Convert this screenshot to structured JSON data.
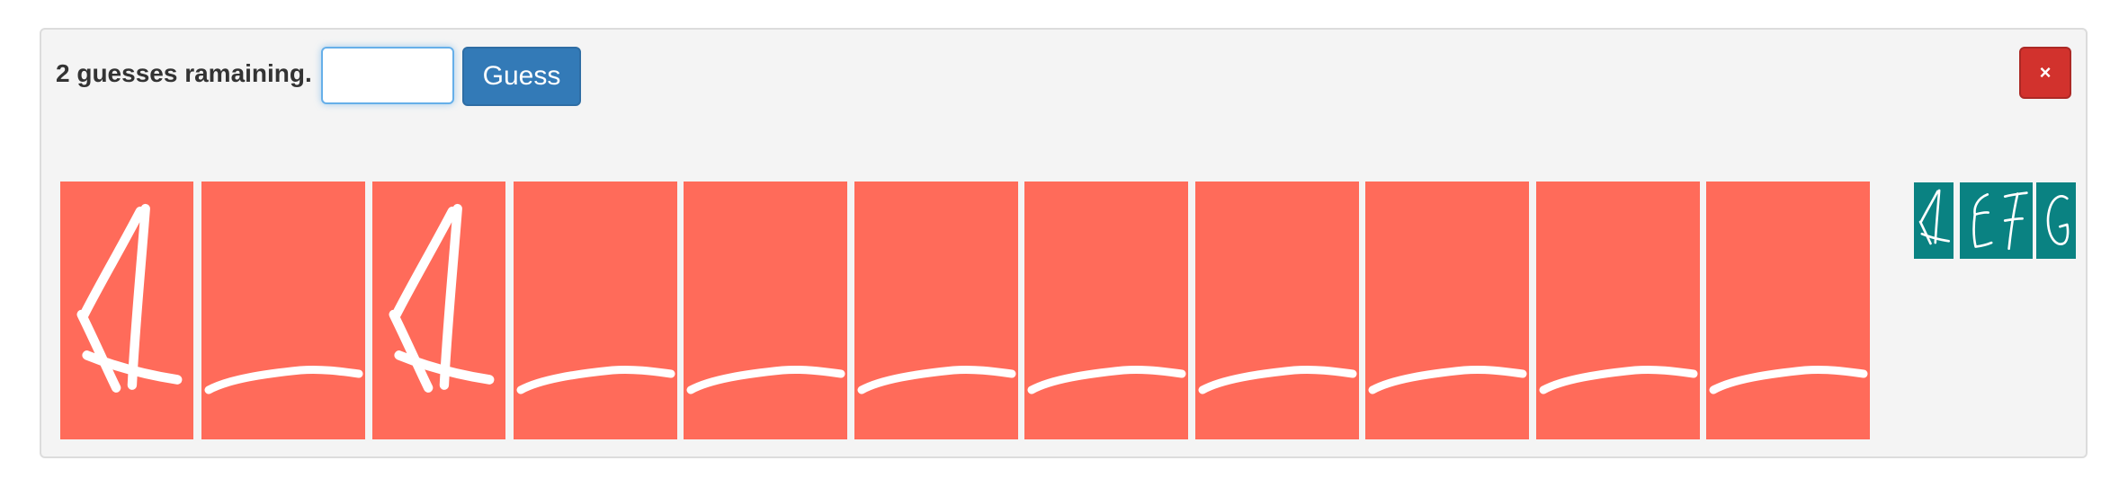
{
  "game": {
    "status_text": "2 guesses ramaining.",
    "input_value": "",
    "guess_button_label": "Guess",
    "close_button_label": "×",
    "word_tiles": [
      {
        "letter": "A",
        "revealed": true
      },
      {
        "letter": "",
        "revealed": false
      },
      {
        "letter": "A",
        "revealed": true
      },
      {
        "letter": "",
        "revealed": false
      },
      {
        "letter": "",
        "revealed": false
      },
      {
        "letter": "",
        "revealed": false
      },
      {
        "letter": "",
        "revealed": false
      },
      {
        "letter": "",
        "revealed": false
      },
      {
        "letter": "",
        "revealed": false
      },
      {
        "letter": "",
        "revealed": false
      },
      {
        "letter": "",
        "revealed": false
      }
    ],
    "guessed_letters": [
      "A",
      "E",
      "F",
      "G"
    ]
  },
  "colors": {
    "tile": "#ff6b5a",
    "guessed_tile": "#0a8282",
    "guess_button": "#337ab7",
    "close_button": "#d2322d",
    "panel": "#f4f4f4"
  },
  "icons": {
    "close": "close-icon"
  }
}
